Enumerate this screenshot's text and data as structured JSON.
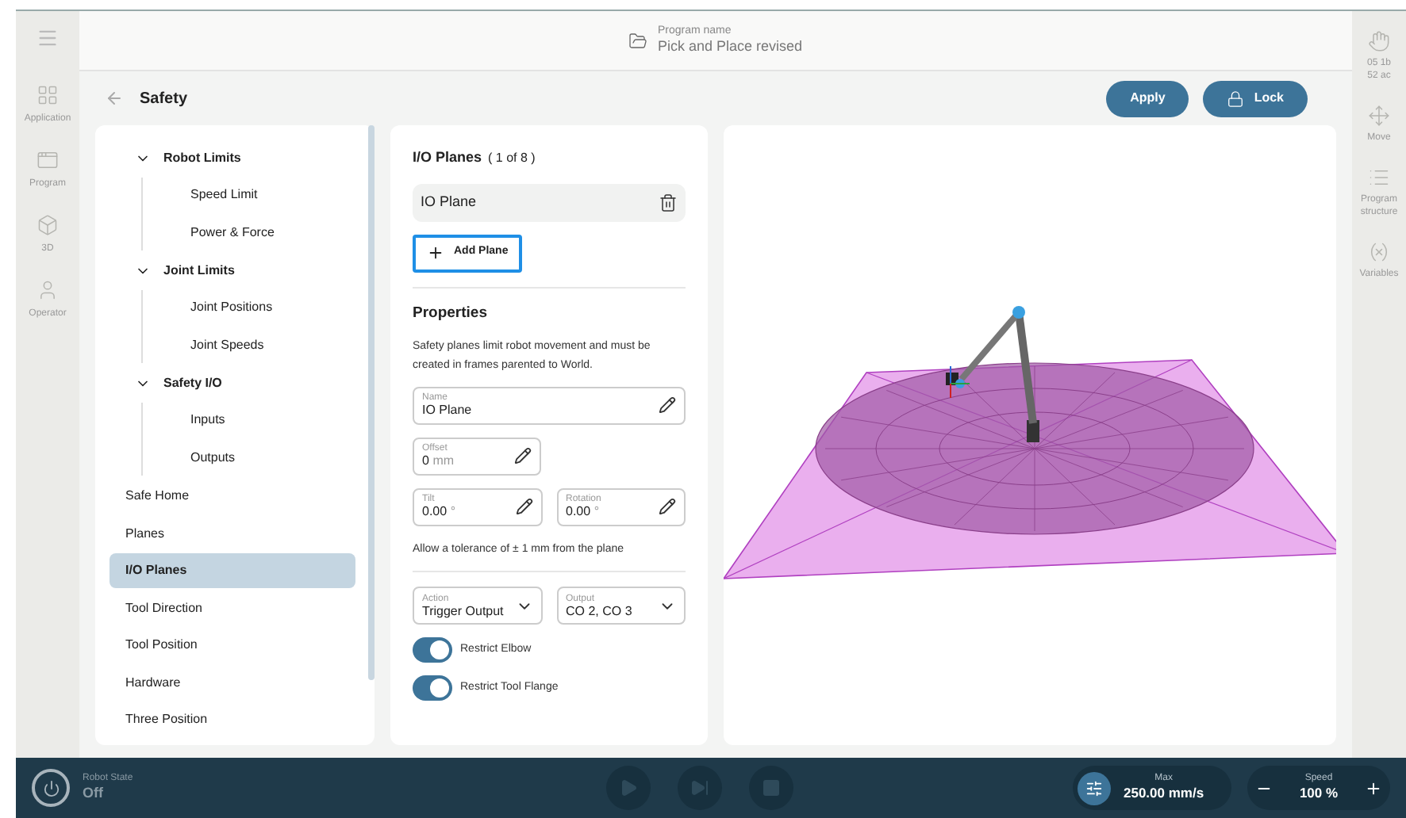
{
  "header": {
    "label": "Program name",
    "program_name": "Pick and Place revised"
  },
  "left_rail": [
    {
      "label": "Application"
    },
    {
      "label": "Program"
    },
    {
      "label": "3D"
    },
    {
      "label": "Operator"
    }
  ],
  "right_rail": [
    {
      "lines": [
        "05 1b",
        "52 ac"
      ]
    },
    {
      "lines": [
        "Move"
      ]
    },
    {
      "lines": [
        "Program",
        "structure"
      ]
    },
    {
      "lines": [
        "Variables"
      ]
    }
  ],
  "page": {
    "title": "Safety",
    "buttons": [
      {
        "label": "Apply"
      },
      {
        "label": "Lock"
      }
    ]
  },
  "nav": [
    {
      "label": "Robot Limits",
      "expanded": true,
      "selected": false,
      "children": [
        {
          "label": "Speed Limit",
          "selected": false
        },
        {
          "label": "Power & Force",
          "selected": false
        }
      ]
    },
    {
      "label": "Joint Limits",
      "expanded": true,
      "selected": false,
      "children": [
        {
          "label": "Joint Positions",
          "selected": false
        },
        {
          "label": "Joint Speeds",
          "selected": false
        }
      ]
    },
    {
      "label": "Safety I/O",
      "expanded": true,
      "selected": false,
      "children": [
        {
          "label": "Inputs",
          "selected": false
        },
        {
          "label": "Outputs",
          "selected": false
        }
      ]
    },
    {
      "label": "Safe Home",
      "selected": false
    },
    {
      "label": "Planes",
      "selected": false
    },
    {
      "label": "I/O Planes",
      "selected": true
    },
    {
      "label": "Tool Direction",
      "selected": false
    },
    {
      "label": "Tool Position",
      "selected": false
    },
    {
      "label": "Hardware",
      "selected": false
    },
    {
      "label": "Three Position",
      "selected": false
    }
  ],
  "planes": {
    "title": "I/O Planes",
    "count": "( 1 of 8 )",
    "items": [
      {
        "name": "IO Plane"
      }
    ],
    "add_button": "Add Plane",
    "add_focused": true
  },
  "properties": {
    "heading": "Properties",
    "description": "Safety planes limit robot movement and must be created in frames parented to World.",
    "field_rows": [
      [
        {
          "kind": "text",
          "label": "Name",
          "value": "IO Plane"
        }
      ],
      [
        {
          "kind": "text",
          "label": "Offset",
          "value": "0",
          "unit": "mm"
        }
      ],
      [
        {
          "kind": "text",
          "label": "Tilt",
          "value": "0.00",
          "unit": "°"
        },
        {
          "kind": "text",
          "label": "Rotation",
          "value": "0.00",
          "unit": "°"
        }
      ]
    ],
    "note": "Allow a tolerance of ± 1 mm from the plane",
    "selects": [
      {
        "kind": "select",
        "label": "Action",
        "value": "Trigger Output"
      },
      {
        "kind": "select",
        "label": "Output",
        "value": "CO 2, CO 3"
      }
    ],
    "toggles": [
      {
        "label": "Restrict Elbow",
        "on": true
      },
      {
        "label": "Restrict Tool Flange",
        "on": true
      }
    ]
  },
  "status_bar": {
    "robot_state_label": "Robot State",
    "robot_state": "Off",
    "max_label": "Max",
    "max_value": "250.00 mm/s",
    "speed_label": "Speed",
    "speed_value": "100 %"
  }
}
